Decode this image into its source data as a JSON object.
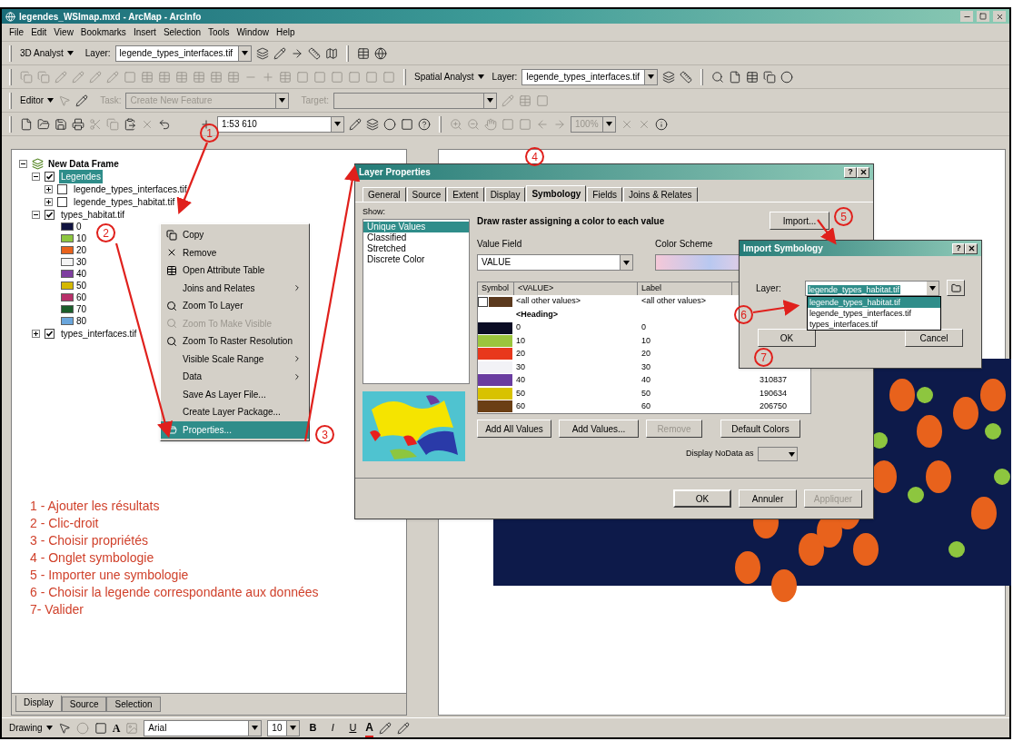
{
  "window": {
    "title": "legendes_WSImap.mxd - ArcMap - ArcInfo"
  },
  "menu": [
    "File",
    "Edit",
    "View",
    "Bookmarks",
    "Insert",
    "Selection",
    "Tools",
    "Window",
    "Help"
  ],
  "toolbars": {
    "analyst_3d": {
      "label": "3D Analyst",
      "layer_label": "Layer:",
      "layer_value": "legende_types_interfaces.tif"
    },
    "spatial_analyst": {
      "label": "Spatial Analyst",
      "layer_label": "Layer:",
      "layer_value": "legende_types_interfaces.tif"
    },
    "editor": {
      "label": "Editor",
      "task_label": "Task:",
      "task_value": "Create New Feature",
      "target_label": "Target:"
    },
    "standard": {
      "scale": "1:53 610",
      "zoom": "100%"
    }
  },
  "toc": {
    "root": "New Data Frame",
    "layers": [
      {
        "name": "Legendes",
        "checked": true,
        "selected": true,
        "expanded": true,
        "children": [
          {
            "name": "legende_types_interfaces.tif",
            "checked": false,
            "selected": false,
            "expanded": false
          },
          {
            "name": "legende_types_habitat.tif",
            "checked": false,
            "selected": false,
            "expanded": false
          }
        ]
      },
      {
        "name": "types_habitat.tif",
        "checked": true,
        "selected": false,
        "expanded": true,
        "legend": [
          {
            "label": "0",
            "color": "#101340"
          },
          {
            "label": "10",
            "color": "#8dc63f"
          },
          {
            "label": "20",
            "color": "#e8621c"
          },
          {
            "label": "30",
            "color": "#f4f4f4"
          },
          {
            "label": "40",
            "color": "#7e3ea0"
          },
          {
            "label": "50",
            "color": "#d4b800"
          },
          {
            "label": "60",
            "color": "#b8306a"
          },
          {
            "label": "70",
            "color": "#1a5e2a"
          },
          {
            "label": "80",
            "color": "#6aa6dc"
          }
        ]
      },
      {
        "name": "types_interfaces.tif",
        "checked": true,
        "selected": false,
        "expanded": false
      }
    ],
    "tabs": [
      {
        "label": "Display",
        "selected": true
      },
      {
        "label": "Source",
        "selected": false
      },
      {
        "label": "Selection",
        "selected": false
      }
    ]
  },
  "context_menu": [
    {
      "label": "Copy",
      "kind": "copy",
      "disabled": false,
      "submenu": false,
      "selected": false
    },
    {
      "label": "Remove",
      "kind": "remove",
      "disabled": false,
      "submenu": false,
      "selected": false
    },
    {
      "label": "Open Attribute Table",
      "kind": "table",
      "disabled": false,
      "submenu": false,
      "selected": false
    },
    {
      "label": "Joins and Relates",
      "kind": "plain",
      "disabled": false,
      "submenu": true,
      "selected": false
    },
    {
      "label": "Zoom To Layer",
      "kind": "zoom",
      "disabled": false,
      "submenu": false,
      "selected": false
    },
    {
      "label": "Zoom To Make Visible",
      "kind": "zoom",
      "disabled": true,
      "submenu": false,
      "selected": false
    },
    {
      "label": "Zoom To Raster Resolution",
      "kind": "zoom",
      "disabled": false,
      "submenu": false,
      "selected": false
    },
    {
      "label": "Visible Scale Range",
      "kind": "plain",
      "disabled": false,
      "submenu": true,
      "selected": false
    },
    {
      "label": "Data",
      "kind": "plain",
      "disabled": false,
      "submenu": true,
      "selected": false
    },
    {
      "label": "Save As Layer File...",
      "kind": "plain",
      "disabled": false,
      "submenu": false,
      "selected": false
    },
    {
      "label": "Create Layer Package...",
      "kind": "plain",
      "disabled": false,
      "submenu": false,
      "selected": false
    },
    {
      "label": "Properties...",
      "kind": "properties",
      "disabled": false,
      "submenu": false,
      "selected": true
    }
  ],
  "notes": [
    "1 - Ajouter les résultats",
    "2 - Clic-droit",
    "3 - Choisir propriétés",
    "4 - Onglet symbologie",
    "5 - Importer une symbologie",
    "6 - Choisir la legende correspondante aux données",
    "7- Valider"
  ],
  "layer_properties": {
    "title": "Layer Properties",
    "help_button": "?",
    "tabs": [
      {
        "label": "General",
        "selected": false
      },
      {
        "label": "Source",
        "selected": false
      },
      {
        "label": "Extent",
        "selected": false
      },
      {
        "label": "Display",
        "selected": false
      },
      {
        "label": "Symbology",
        "selected": true
      },
      {
        "label": "Fields",
        "selected": false
      },
      {
        "label": "Joins & Relates",
        "selected": false
      }
    ],
    "show_label": "Show:",
    "show_items": [
      {
        "label": "Unique Values",
        "selected": true
      },
      {
        "label": "Classified",
        "selected": false
      },
      {
        "label": "Stretched",
        "selected": false
      },
      {
        "label": "Discrete Color",
        "selected": false
      }
    ],
    "description": "Draw raster assigning a color to each value",
    "import_button": "Import...",
    "value_field_label": "Value Field",
    "value_field": "VALUE",
    "color_scheme_label": "Color Scheme",
    "columns": [
      "Symbol",
      "<VALUE>",
      "Label"
    ],
    "rows": [
      {
        "kind": "other",
        "checked": false,
        "color": "#5c3a1e",
        "value": "<all other values>",
        "label": "<all other values>"
      },
      {
        "kind": "heading",
        "value": "<Heading>"
      },
      {
        "kind": "value",
        "color": "#0b0d24",
        "value": "0",
        "label": "0"
      },
      {
        "kind": "value",
        "color": "#9bc53d",
        "value": "10",
        "label": "10"
      },
      {
        "kind": "value",
        "color": "#e8381c",
        "value": "20",
        "label": "20"
      },
      {
        "kind": "value",
        "color": "#f2f2f6",
        "value": "30",
        "label": "30"
      },
      {
        "kind": "value",
        "color": "#6a3ca0",
        "value": "40",
        "label": "40",
        "count": "310837"
      },
      {
        "kind": "value",
        "color": "#d8c200",
        "value": "50",
        "label": "50",
        "count": "190634"
      },
      {
        "kind": "value",
        "color": "#6b3f14",
        "value": "60",
        "label": "60",
        "count": "206750"
      }
    ],
    "buttons": [
      {
        "label": "Add All Values",
        "disabled": false
      },
      {
        "label": "Add Values...",
        "disabled": false
      },
      {
        "label": "Remove",
        "disabled": true
      },
      {
        "label": "Default Colors",
        "disabled": false
      }
    ],
    "nodata_label": "Display NoData as",
    "footer_buttons": [
      {
        "label": "OK",
        "disabled": false
      },
      {
        "label": "Annuler",
        "disabled": false
      },
      {
        "label": "Appliquer",
        "disabled": true
      }
    ]
  },
  "import_symbology": {
    "title": "Import Symbology",
    "help_button": "?",
    "layer_label": "Layer:",
    "layer_value": "legende_types_habitat.tif",
    "options": [
      {
        "label": "legende_types_habitat.tif",
        "selected": true
      },
      {
        "label": "legende_types_interfaces.tif",
        "selected": false
      },
      {
        "label": "types_interfaces.tif",
        "selected": false
      }
    ],
    "buttons": [
      "OK",
      "Cancel"
    ]
  },
  "annotations": [
    "1",
    "2",
    "3",
    "4",
    "5",
    "6",
    "7"
  ],
  "drawing_toolbar": {
    "label": "Drawing",
    "text_tool": "A",
    "font": "Arial",
    "size": "10",
    "bold": "B",
    "italic": "I",
    "underline": "U",
    "font_color": "A"
  }
}
